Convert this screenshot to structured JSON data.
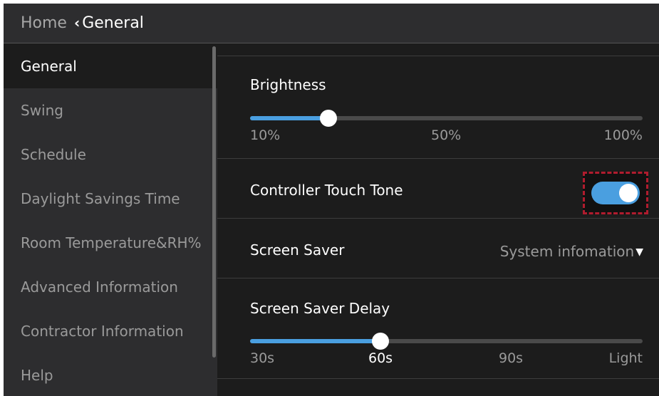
{
  "header": {
    "home_label": "Home",
    "current_label": "General"
  },
  "sidebar": {
    "items": [
      {
        "label": "General",
        "active": true
      },
      {
        "label": "Swing"
      },
      {
        "label": "Schedule"
      },
      {
        "label": "Daylight Savings Time"
      },
      {
        "label": "Room Temperature&RH%"
      },
      {
        "label": "Advanced Information"
      },
      {
        "label": "Contractor Information"
      },
      {
        "label": "Help"
      }
    ]
  },
  "settings": {
    "brightness": {
      "label": "Brightness",
      "value_fraction": 0.2,
      "ticks": [
        "10%",
        "50%",
        "100%"
      ]
    },
    "touch_tone": {
      "label": "Controller Touch Tone",
      "enabled": true
    },
    "screen_saver": {
      "label": "Screen Saver",
      "value": "System infomation"
    },
    "screen_saver_delay": {
      "label": "Screen Saver Delay",
      "value_fraction": 0.333,
      "ticks": [
        "30s",
        "60s",
        "90s",
        "Light"
      ],
      "selected": "60s"
    }
  },
  "colors": {
    "accent": "#4a9fe0",
    "highlight_border": "#b01c2e"
  }
}
